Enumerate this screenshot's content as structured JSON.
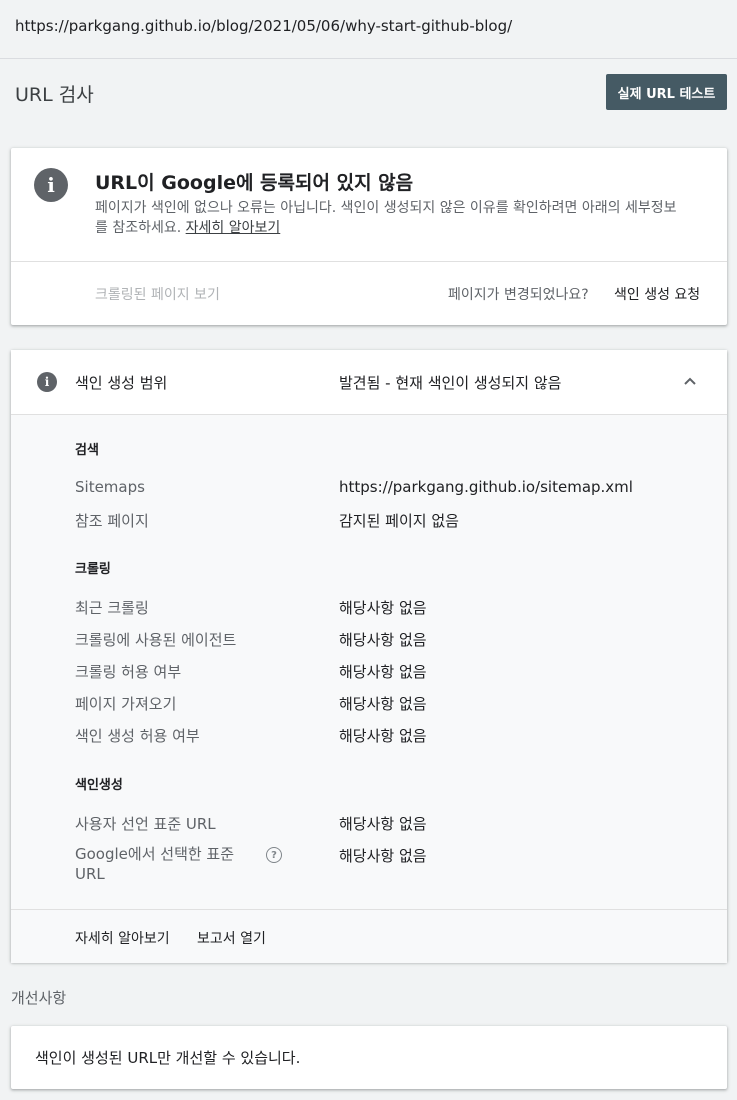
{
  "url_bar": {
    "url": "https://parkgang.github.io/blog/2021/05/06/why-start-github-blog/"
  },
  "header": {
    "title": "URL 검사",
    "live_test_label": "실제 URL 테스트"
  },
  "status_card": {
    "icon": "info-icon",
    "title": "URL이 Google에 등록되어 있지 않음",
    "description": "페이지가 색인에 없으나 오류는 아닙니다. 색인이 생성되지 않은 이유를 확인하려면 아래의 세부정보를 참조하세요.",
    "learn_more": "자세히 알아보기",
    "view_crawled_page": "크롤링된 페이지 보기",
    "page_changed_question": "페이지가 변경되었나요?",
    "request_indexing": "색인 생성 요청"
  },
  "coverage": {
    "icon": "info-icon",
    "label": "색인 생성 범위",
    "status": "발견됨 - 현재 색인이 생성되지 않음",
    "sections": {
      "discovery": {
        "heading": "검색",
        "rows": [
          {
            "label": "Sitemaps",
            "value": "https://parkgang.github.io/sitemap.xml"
          },
          {
            "label": "참조 페이지",
            "value": "감지된 페이지 없음"
          }
        ]
      },
      "crawl": {
        "heading": "크롤링",
        "rows": [
          {
            "label": "최근 크롤링",
            "value": "해당사항 없음"
          },
          {
            "label": "크롤링에 사용된 에이전트",
            "value": "해당사항 없음"
          },
          {
            "label": "크롤링 허용 여부",
            "value": "해당사항 없음"
          },
          {
            "label": "페이지 가져오기",
            "value": "해당사항 없음"
          },
          {
            "label": "색인 생성 허용 여부",
            "value": "해당사항 없음"
          }
        ]
      },
      "indexing": {
        "heading": "색인생성",
        "rows": [
          {
            "label": "사용자 선언 표준 URL",
            "value": "해당사항 없음"
          },
          {
            "label": "Google에서 선택한 표준 URL",
            "value": "해당사항 없음"
          }
        ]
      }
    },
    "footer": {
      "learn_more": "자세히 알아보기",
      "open_report": "보고서 열기"
    }
  },
  "enhancements": {
    "title": "개선사항",
    "message": "색인이 생성된 URL만 개선할 수 있습니다."
  },
  "colors": {
    "button_bg": "#455a64",
    "page_bg": "#f1f3f4",
    "icon_gray": "#5f6368"
  }
}
